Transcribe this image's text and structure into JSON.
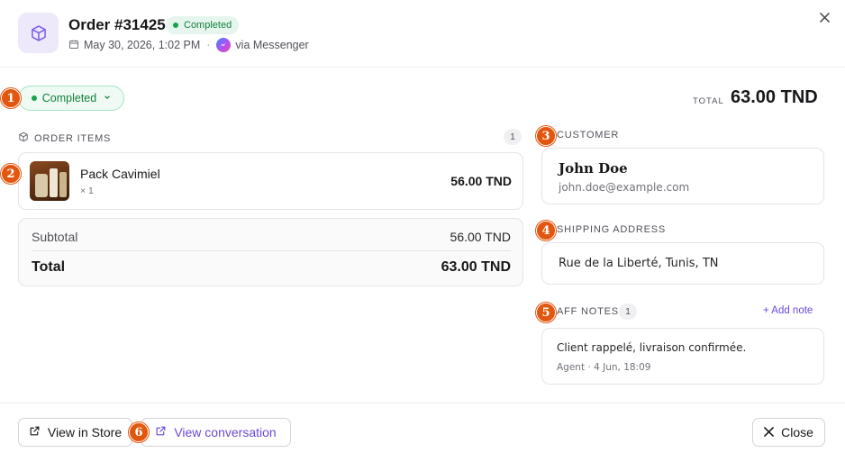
{
  "header": {
    "title": "Order #31425",
    "status_badge": "Completed",
    "date": "May 30, 2026, 1:02 PM",
    "separator": "·",
    "channel": "via Messenger",
    "icons": {
      "order": "package-icon",
      "date": "calendar-icon",
      "channel": "messenger-icon",
      "close": "close-icon"
    }
  },
  "status": {
    "selected": "Completed"
  },
  "total": {
    "label": "TOTAL",
    "value": "63.00 TND"
  },
  "order_items": {
    "label": "ORDER ITEMS",
    "count": "1",
    "items": [
      {
        "name": "Pack Cavimiel",
        "qty": "× 1",
        "price": "56.00 TND"
      }
    ],
    "subtotal_label": "Subtotal",
    "subtotal_value": "56.00 TND",
    "total_label": "Total",
    "total_value": "63.00 TND"
  },
  "customer": {
    "label": "CUSTOMER",
    "name": "John Doe",
    "email": "john.doe@example.com"
  },
  "shipping": {
    "label": "SHIPPING ADDRESS",
    "address": "Rue de la Liberté, Tunis, TN"
  },
  "notes": {
    "label": "AFF NOTES",
    "count": "1",
    "add_label": "+ Add note",
    "items": [
      {
        "text": "Client rappelé, livraison confirmée.",
        "meta": "Agent · 4 Jun, 18:09"
      }
    ]
  },
  "footer": {
    "view_store": "View in Store",
    "view_conversation": "View conversation",
    "close": "Close"
  },
  "markers": [
    "1",
    "2",
    "3",
    "4",
    "5",
    "6"
  ],
  "colors": {
    "accent": "#6d48e0",
    "success": "#15803d",
    "marker": "#e2570f"
  }
}
